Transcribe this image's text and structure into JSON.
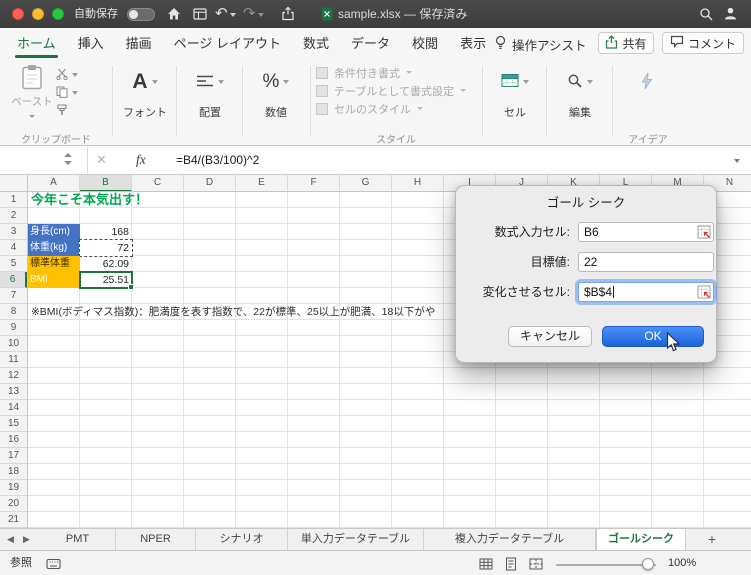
{
  "icons": {
    "undo": "↶",
    "redo": "↷",
    "cancel": "✕",
    "fx": "fx",
    "font_glyph": "A",
    "percent_glyph": "%",
    "prev_sheet": "◀",
    "next_sheet": "▶",
    "add_sheet": "+"
  },
  "colors": {
    "accent_green": "#217346",
    "cell_blue": "#4472C4",
    "cell_orange": "#FFC000",
    "ok_blue": "#1c63d9",
    "title_text_green": "#00A650"
  },
  "titlebar": {
    "autosave_label": "自動保存",
    "document_title": "sample.xlsx — 保存済み"
  },
  "ribbon": {
    "tabs": [
      {
        "label": "ホーム",
        "active": true
      },
      {
        "label": "挿入"
      },
      {
        "label": "描画"
      },
      {
        "label": "ページ レイアウト"
      },
      {
        "label": "数式"
      },
      {
        "label": "データ"
      },
      {
        "label": "校閲"
      },
      {
        "label": "表示"
      }
    ],
    "assist_label": "操作アシスト",
    "share_label": "共有",
    "comment_label": "コメント",
    "paste_label": "ペースト",
    "clipboard_group_label": "クリップボード",
    "font_label": "フォント",
    "align_label": "配置",
    "number_label": "数値",
    "style_rows": [
      "条件付き書式",
      "テーブルとして書式設定",
      "セルのスタイル"
    ],
    "style_group_label": "スタイル",
    "cells_label": "セル",
    "edit_label": "編集",
    "ideas_label": "アイデア"
  },
  "formula_bar": {
    "formula": "=B4/(B3/100)^2"
  },
  "grid": {
    "columns": [
      "A",
      "B",
      "C",
      "D",
      "E",
      "F",
      "G",
      "H",
      "I",
      "J",
      "K",
      "L",
      "M",
      "N"
    ],
    "rows": [
      "1",
      "2",
      "3",
      "4",
      "5",
      "6",
      "7",
      "8",
      "9",
      "10",
      "11",
      "12",
      "13",
      "14",
      "15",
      "16",
      "17",
      "18",
      "19",
      "20",
      "21"
    ],
    "cells": {
      "a1": "今年こそ本気出す！",
      "a3": "身長(cm)",
      "b3": "168",
      "a4": "体重(kg)",
      "b4": "72",
      "a5": "標準体重",
      "b5": "62.09",
      "a6": "BMI",
      "b6": "25.51",
      "a8_note": "※BMI(ボディマス指数)：肥満度を表す指数で、22が標準、25以上が肥満、18以下がや"
    }
  },
  "dialog": {
    "title": "ゴール シーク",
    "fields": [
      {
        "label": "数式入力セル:",
        "value": "B6"
      },
      {
        "label": "目標値:",
        "value": "22"
      },
      {
        "label": "変化させるセル:",
        "value": "$B$4"
      }
    ],
    "cancel_label": "キャンセル",
    "ok_label": "OK"
  },
  "sheet_tabs": {
    "tabs": [
      {
        "label": "PMT"
      },
      {
        "label": "NPER"
      },
      {
        "label": "シナリオ"
      },
      {
        "label": "単入力データテーブル"
      },
      {
        "label": "複入力データテーブル"
      },
      {
        "label": "ゴールシーク",
        "active": true
      }
    ]
  },
  "status_bar": {
    "mode": "参照",
    "zoom": "100%"
  }
}
